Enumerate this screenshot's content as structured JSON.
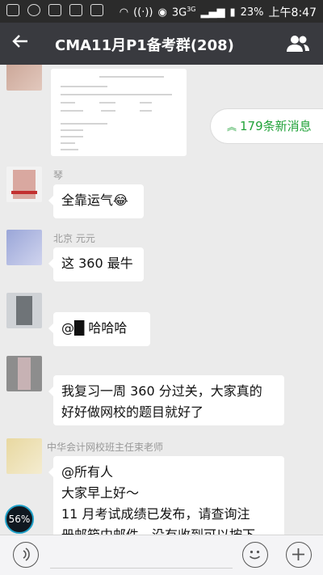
{
  "status_bar": {
    "network": "3G",
    "network_sup": "3G",
    "battery": "23%",
    "time": "上午8:47"
  },
  "header": {
    "back_icon": "arrow-left-icon",
    "title": "CMA11月P1备考群(208)",
    "members_icon": "group-members-icon"
  },
  "new_messages": {
    "icon": "double-chevron-up-icon",
    "label": "179条新消息"
  },
  "messages": [
    {
      "sender": "琴",
      "text": "全靠运气😂"
    },
    {
      "sender": "北京 元元",
      "text": "这 360 最牛"
    },
    {
      "sender": "",
      "text": "@█  哈哈哈"
    },
    {
      "sender": "",
      "text_lines": [
        "我复习一周 360 分过关，大家真的",
        "好好做网校的题目就好了"
      ]
    },
    {
      "sender": "中华会计网校班主任束老师",
      "text_lines": [
        "@所有人",
        "大家早上好～",
        "11 月考试成绩已发布，请查询注",
        "册邮箱中邮件，没有收到可以按下"
      ]
    }
  ],
  "floating_gauge": {
    "value": "56%"
  },
  "input_bar": {
    "voice_icon": "voice-icon",
    "emoji_icon": "emoji-icon",
    "plus_icon": "plus-icon"
  }
}
